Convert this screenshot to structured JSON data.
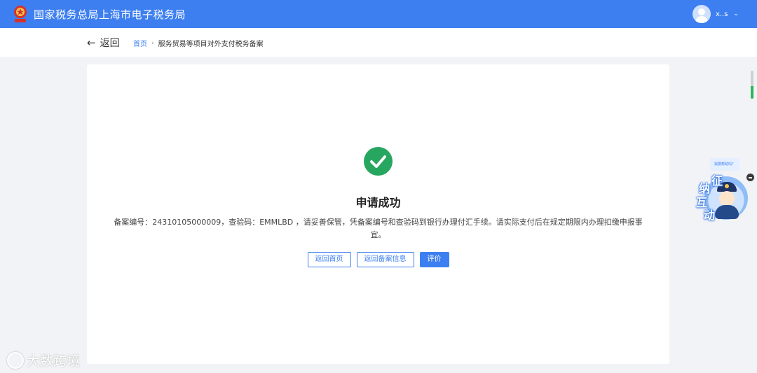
{
  "header": {
    "site_title": "国家税务总局上海市电子税务局",
    "username": "x..s",
    "emblem_icon": "tax-emblem-icon",
    "brand_color": "#3d7ff0"
  },
  "nav": {
    "back_label": "返回",
    "breadcrumb": {
      "home": "首页",
      "current": "服务贸易等项目对外支付税务备案"
    }
  },
  "result": {
    "icon": "check-circle-icon",
    "icon_color": "#27a660",
    "title": "申请成功",
    "description": "备案编号：24310105000009，查验码：EMMLBD ，请妥善保管，凭备案编号和查验码到银行办理付汇手续。请实际支付后在规定期限内办理扣缴申报事宜。"
  },
  "actions": {
    "home_button": "返回首页",
    "record_button": "返回备案信息",
    "rate_button": "评价"
  },
  "assistant": {
    "bubble": "需要帮助吗？",
    "chars": [
      "征",
      "纳",
      "互",
      "动"
    ]
  },
  "watermark": {
    "text": "大数跨境"
  }
}
